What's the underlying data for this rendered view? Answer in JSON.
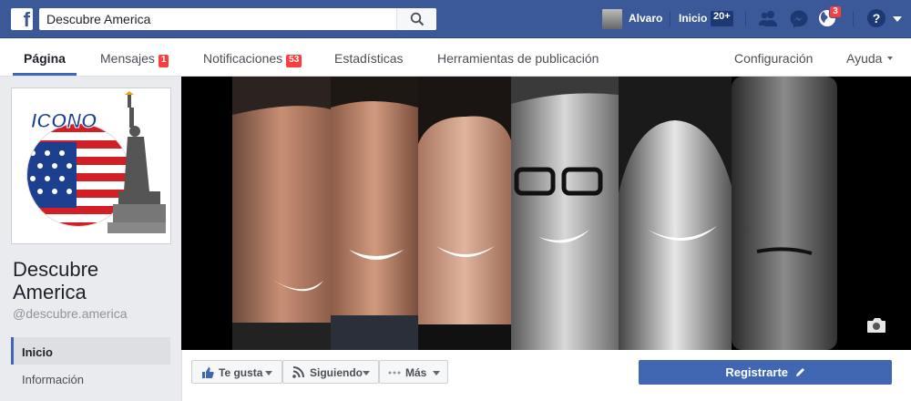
{
  "topbar": {
    "search_value": "Descubre America",
    "user_name": "Alvaro",
    "home_label": "Inicio",
    "home_count": "20+",
    "notifications_count": "3"
  },
  "page_nav": {
    "items": [
      {
        "label": "Página"
      },
      {
        "label": "Mensajes",
        "badge": "1"
      },
      {
        "label": "Notificaciones",
        "badge": "53"
      },
      {
        "label": "Estadísticas"
      },
      {
        "label": "Herramientas de publicación"
      },
      {
        "label": "Configuración"
      },
      {
        "label": "Ayuda"
      }
    ]
  },
  "profile": {
    "logo_text": "ICONO",
    "page_name": "Descubre America",
    "handle": "@descubre.america"
  },
  "left_nav": {
    "items": [
      {
        "label": "Inicio"
      },
      {
        "label": "Información"
      }
    ]
  },
  "actions": {
    "like_label": "Te gusta",
    "follow_label": "Siguiendo",
    "more_label": "Más",
    "register_label": "Registrarte"
  },
  "colors": {
    "facebook_blue": "#3b5998",
    "button_blue": "#4267b2",
    "badge_red": "#fa3e3e"
  }
}
